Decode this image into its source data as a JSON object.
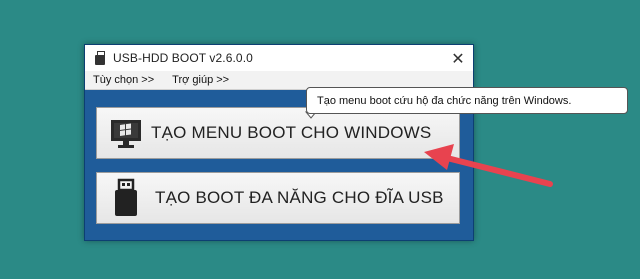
{
  "window": {
    "title": "USB-HDD BOOT v2.6.0.0",
    "close_glyph": "✕"
  },
  "menu": {
    "items": [
      {
        "label": "Tùy chọn >>"
      },
      {
        "label": "Trợ giúp >>"
      }
    ]
  },
  "buttons": {
    "create_windows_boot_menu": {
      "label": "TẠO MENU BOOT CHO WINDOWS",
      "icon": "monitor-windows-icon"
    },
    "create_usb_multiboot": {
      "label": "TẠO BOOT ĐA NĂNG CHO ĐĨA USB",
      "icon": "usb-drive-icon"
    }
  },
  "tooltip": {
    "text": "Tạo menu boot cứu hộ đa chức năng trên Windows."
  },
  "colors": {
    "desktop": "#2b8a86",
    "window_body": "#1f5c9a",
    "annotation_arrow": "#e8434f"
  }
}
